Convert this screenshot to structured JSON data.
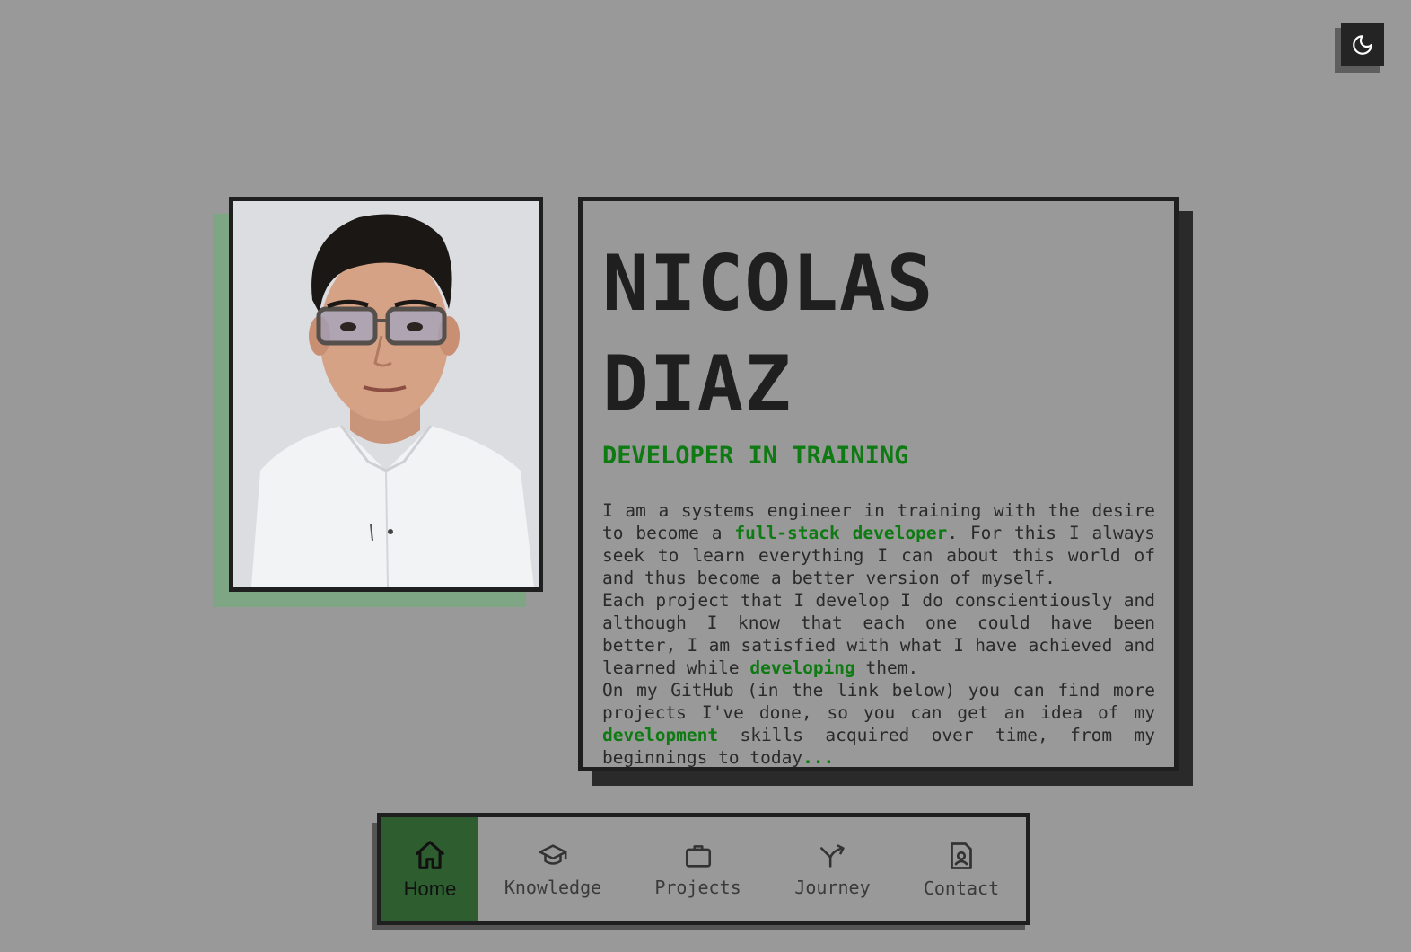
{
  "theme_toggle": {
    "icon": "moon-icon"
  },
  "profile": {
    "photo": "portrait-photo",
    "name_line1": "NICOLAS",
    "name_line2": "DIAZ",
    "subtitle": "DEVELOPER IN TRAINING",
    "bio": {
      "p1_a": "I am a systems engineer in training with the desire to become a ",
      "p1_hl": "full-stack developer",
      "p1_b": ". For this I always seek to learn everything I can about this world of and thus become a better version of myself.",
      "p2_a": "Each project that I develop I do conscientiously and although I know that each one could have been better, I am satisfied with what I have achieved and learned while ",
      "p2_hl": "developing",
      "p2_b": " them.",
      "p3_a": "On my GitHub (in the link below) you can find more projects I've done, so you can get an idea of my ",
      "p3_hl": "development",
      "p3_b": " skills acquired over time, from my beginnings to today",
      "p3_dots": "..."
    }
  },
  "nav": {
    "items": [
      {
        "label": "Home",
        "icon": "home-icon",
        "active": true
      },
      {
        "label": "Knowledge",
        "icon": "graduation-cap-icon",
        "active": false
      },
      {
        "label": "Projects",
        "icon": "briefcase-icon",
        "active": false
      },
      {
        "label": "Journey",
        "icon": "split-arrow-icon",
        "active": false
      },
      {
        "label": "Contact",
        "icon": "contact-card-icon",
        "active": false
      }
    ]
  },
  "colors": {
    "background": "#999999",
    "accent_green": "#0e7a12",
    "active_nav": "#2e5e30",
    "photo_shadow": "#7ea584",
    "dark": "#1f1f1f"
  }
}
